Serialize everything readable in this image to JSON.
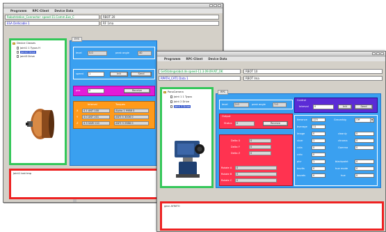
{
  "w1": {
    "menu": [
      "Programm",
      "RPC-Client",
      "Device Data"
    ],
    "addr": "Robotstation_Connector: speed-11.Comm.Exe_C",
    "addr_right": "RBOT 20",
    "path": "ESA Dellicable 1",
    "path_right": "RF  1ma",
    "tree": {
      "root": "Device Classes",
      "items": [
        "Joint1 1 Typus H",
        "joint2 Drive",
        "joint3 Drive"
      ]
    },
    "tab": "EYS",
    "level": {
      "label": "level",
      "value": "5.0",
      "right_label": "peak angle",
      "right_value": "40"
    },
    "speed": {
      "label": "speed",
      "value": "1",
      "btn1": "Init",
      "btn2": "Send"
    },
    "pos": {
      "label": "pos",
      "value": "0",
      "btn": "Receive"
    },
    "table": {
      "headers": [
        "Interval",
        "Torques"
      ],
      "rows": [
        {
          "k": "X",
          "a": "4.1 ANT 100",
          "b": "Alpha 1 9988 0"
        },
        {
          "k": "Y",
          "a": "4.0 ANT 201",
          "b": "ANTI 5 3006 0"
        },
        {
          "k": "Z",
          "a": "4.3 SAM 110",
          "b": "ANTI 3 2986 0"
        }
      ]
    },
    "log": "Joint1 lost tmp"
  },
  "w2": {
    "menu": [
      "Programm",
      "RPC-Client",
      "Device Data"
    ],
    "addr": "GetState@robot.de.speed-11.3.09.09.NT_OK",
    "addr_right": "RBOT 10",
    "path": "RPATH_CAT1 Data 1",
    "path_right": "RBOT  Ima",
    "tree": {
      "root": "PanoCamera",
      "items": [
        "Joint 1 1 Typus",
        "Joint 2 Drive",
        "Joint 3 Drive"
      ]
    },
    "tab": "RPC",
    "level": {
      "label": "level",
      "value": "2.0",
      "right_label": "peak angle",
      "right_value": "7.0"
    },
    "control": {
      "title": "Control",
      "label": "Interval",
      "value": "0",
      "btn1": "Init",
      "btn2": "Send"
    },
    "output": {
      "title": "Output",
      "label": "Status",
      "value": "0",
      "btn": "Receive"
    },
    "deltas": [
      {
        "label": "Delta X",
        "value": "0"
      },
      {
        "label": "Delta Y",
        "value": "0"
      },
      {
        "label": "Delta Z",
        "value": "0"
      }
    ],
    "rotations": [
      {
        "label": "Rotate A",
        "value": "0"
      },
      {
        "label": "Rotate B",
        "value": "0"
      },
      {
        "label": "Rotate C",
        "value": "0"
      }
    ],
    "params_left": [
      {
        "label": "Iterance",
        "value": "125"
      },
      {
        "label": "bverage",
        "value": "11"
      },
      {
        "label": "Image",
        "value": "0"
      },
      {
        "label": "vicer",
        "value": "1"
      },
      {
        "label": "cvta",
        "value": "0"
      },
      {
        "label": "cvto",
        "value": "0"
      },
      {
        "label": "picr",
        "value": "1"
      },
      {
        "label": "bovits",
        "value": "0"
      },
      {
        "label": "bovats",
        "value": "0"
      }
    ],
    "params_right": [
      {
        "label": "Gravarbig",
        "value": "Off"
      },
      {
        "label": "cleanly",
        "value": "0"
      },
      {
        "label": "chroma",
        "value": "0"
      },
      {
        "label": "Gamma",
        "value": "0"
      },
      {
        "label": "blackpoint",
        "value": "0"
      },
      {
        "label": "hue mode",
        "value": "0"
      },
      {
        "label": "hue",
        "value": "0"
      }
    ],
    "log": "gear  AFINTO"
  }
}
